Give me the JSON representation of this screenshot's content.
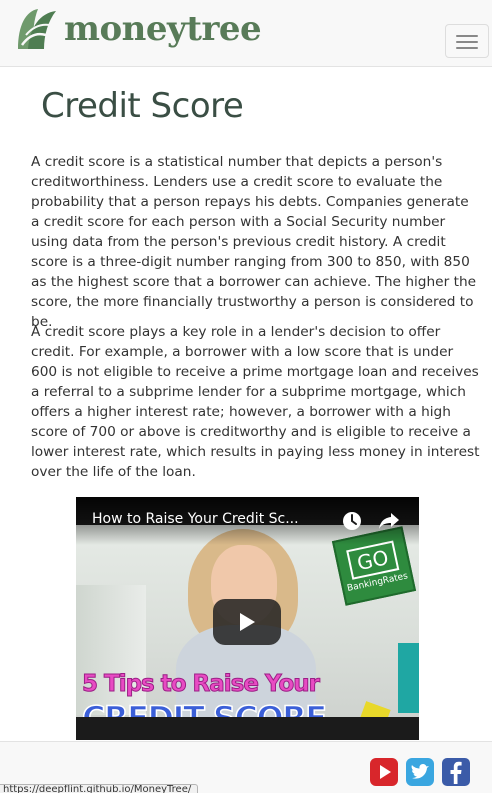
{
  "navbar": {
    "brand": "moneytree",
    "toggle_icon": "hamburger-menu-icon"
  },
  "page": {
    "title": "Credit Score",
    "paragraphs": [
      "A credit score is a statistical number that depicts a person's creditworthiness. Lenders use a credit score to evaluate the probability that a person repays his debts. Companies generate a credit score for each person with a Social Security number using data from the person's previous credit history. A credit score is a three-digit number ranging from 300 to 850, with 850 as the highest score that a borrower can achieve. The higher the score, the more financially trustworthy a person is considered to be.",
      "A credit score plays a key role in a lender's decision to offer credit. For example, a borrower with a low score that is under 600 is not eligible to receive a prime mortgage loan and receives a referral to a subprime lender for a subprime mortgage, which offers a higher interest rate; however, a borrower with a high score of 700 or above is creditworthy and is eligible to receive a lower interest rate, which results in paying less money in interest over the life of the loan."
    ]
  },
  "video": {
    "title": "How to Raise Your Credit Sc...",
    "badge_main": "GO",
    "badge_sub": "BankingRates",
    "overlay_line1": "5 Tips to Raise Your",
    "overlay_line2": "CREDIT SCORE",
    "icons": [
      "clock-icon",
      "share-icon",
      "play-icon"
    ]
  },
  "footer": {
    "social": [
      "youtube-icon",
      "twitter-icon",
      "facebook-icon"
    ]
  },
  "status_bar": {
    "url": "https://deepflint.github.io/MoneyTree/"
  },
  "colors": {
    "brand_green": "#587b58",
    "title": "#3a4e44",
    "navbar_bg": "#f8f8f8"
  }
}
